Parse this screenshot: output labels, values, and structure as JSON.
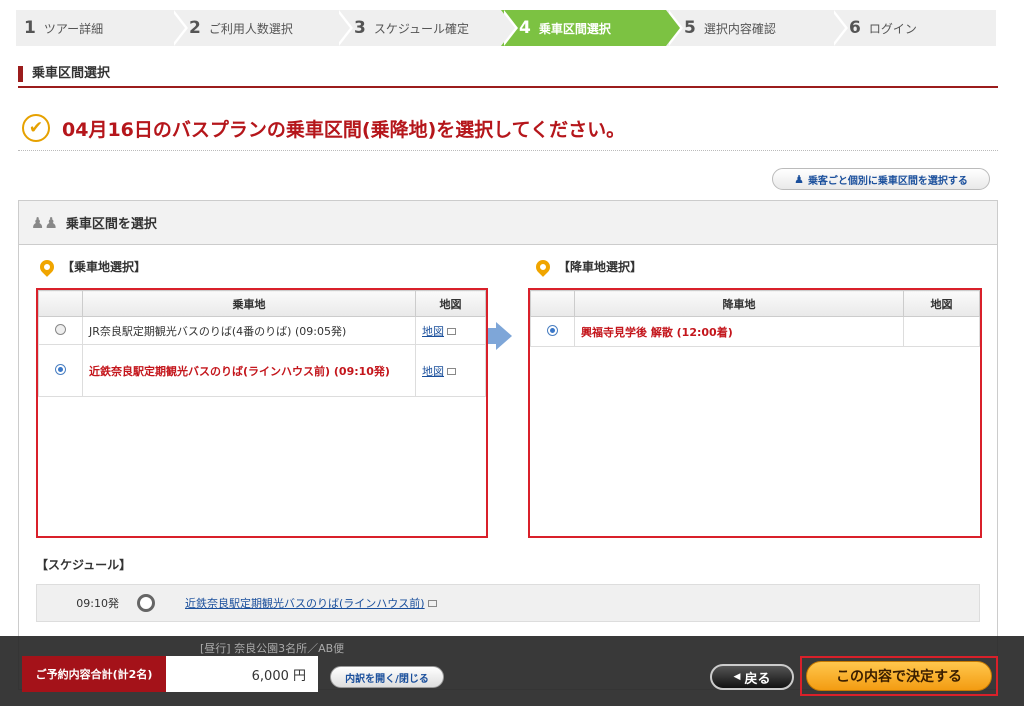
{
  "steps": [
    {
      "num": "1",
      "label": "ツアー詳細"
    },
    {
      "num": "2",
      "label": "ご利用人数選択"
    },
    {
      "num": "3",
      "label": "スケジュール確定"
    },
    {
      "num": "4",
      "label": "乗車区間選択"
    },
    {
      "num": "5",
      "label": "選択内容確認"
    },
    {
      "num": "6",
      "label": "ログイン"
    }
  ],
  "active_step": "4",
  "section_title": "乗車区間選択",
  "heading": "04月16日のバスプランの乗車区間(乗降地)を選択してください。",
  "individual_button": "乗客ごと個別に乗車区間を選択する",
  "panel_title": "乗車区間を選択",
  "boarding": {
    "label": "【乗車地選択】",
    "col_place": "乗車地",
    "col_map": "地図",
    "rows": [
      {
        "place": "JR奈良駅定期観光バスのりば(4番のりば) (09:05発)",
        "map": "地図",
        "selected": false
      },
      {
        "place": "近鉄奈良駅定期観光バスのりば(ラインハウス前) (09:10発)",
        "map": "地図",
        "selected": true
      }
    ]
  },
  "alighting": {
    "label": "【降車地選択】",
    "col_place": "降車地",
    "col_map": "地図",
    "rows": [
      {
        "place": "興福寺見学後 解散 (12:00着)",
        "map": "",
        "selected": true
      }
    ]
  },
  "schedule": {
    "label": "【スケジュール】",
    "time": "09:10発",
    "stop": "近鉄奈良駅定期観光バスのりば(ラインハウス前)",
    "partial_text": "[昼行] 奈良公園3名所／AB便"
  },
  "footer": {
    "total_label": "ご予約内容合計(計2名)",
    "total_value": "6,000 円",
    "breakdown_button": "内訳を開く/閉じる",
    "back_button": "戻る",
    "confirm_button": "この内容で決定する"
  },
  "colors": {
    "accent_red": "#b5161b",
    "active_green": "#7cc242",
    "confirm_orange": "#f39c12"
  }
}
